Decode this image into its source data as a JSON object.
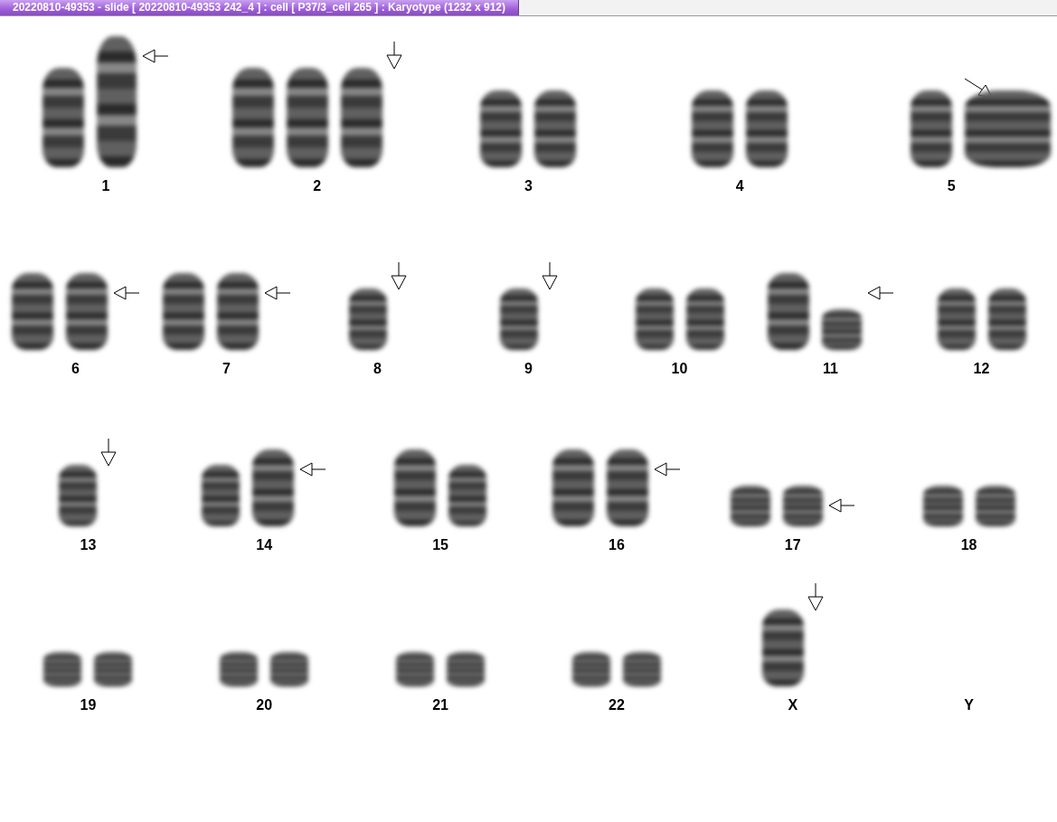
{
  "window": {
    "title": "20220810-49353 - slide [ 20220810-49353 242_4 ] : cell [ P37/3_cell 265 ] : Karyotype  (1232 x 912)"
  },
  "rows": [
    [
      {
        "label": "1",
        "kind": "left"
      },
      {
        "label": "2",
        "kind": "down"
      },
      {
        "label": "3",
        "kind": "plain"
      },
      {
        "label": "4",
        "kind": "plain"
      },
      {
        "label": "5",
        "kind": "diagonal"
      }
    ],
    [
      {
        "label": "6",
        "kind": "left"
      },
      {
        "label": "7",
        "kind": "left"
      },
      {
        "label": "8",
        "kind": "down"
      },
      {
        "label": "9",
        "kind": "down"
      },
      {
        "label": "10",
        "kind": "plain"
      },
      {
        "label": "11",
        "kind": "left"
      },
      {
        "label": "12",
        "kind": "plain"
      }
    ],
    [
      {
        "label": "13",
        "kind": "down"
      },
      {
        "label": "14",
        "kind": "left"
      },
      {
        "label": "15",
        "kind": "plain"
      },
      {
        "label": "16",
        "kind": "left"
      },
      {
        "label": "17",
        "kind": "left"
      },
      {
        "label": "18",
        "kind": "plain"
      }
    ],
    [
      {
        "label": "19",
        "kind": "plain"
      },
      {
        "label": "20",
        "kind": "plain"
      },
      {
        "label": "21",
        "kind": "plain"
      },
      {
        "label": "22",
        "kind": "plain"
      },
      {
        "label": "X",
        "kind": "down"
      },
      {
        "label": "Y",
        "kind": "plain"
      }
    ]
  ]
}
